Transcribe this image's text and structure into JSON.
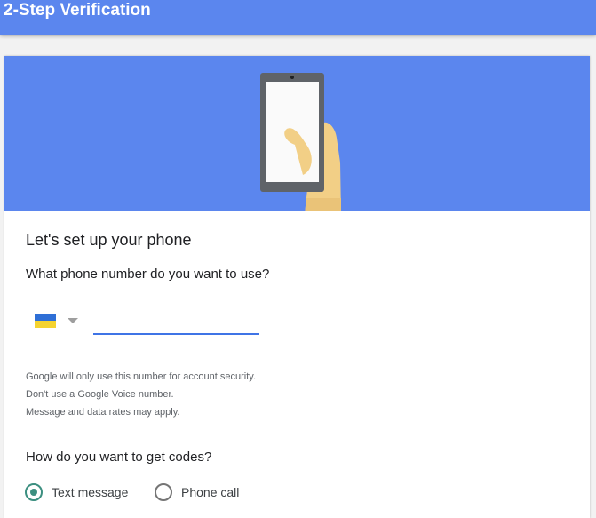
{
  "header": {
    "title": "2-Step Verification"
  },
  "hero": {
    "illustration": "hand-holding-phone",
    "background_color": "#5b86ee"
  },
  "setup": {
    "heading": "Let's set up your phone",
    "phone_question": "What phone number do you want to use?",
    "country": {
      "flag": "ukraine-flag-icon",
      "caret": "caret-down-icon"
    },
    "phone_input": {
      "value": "",
      "placeholder": ""
    },
    "notes": [
      "Google will only use this number for account security.",
      "Don't use a Google Voice number.",
      "Message and data rates may apply."
    ]
  },
  "codes": {
    "question": "How do you want to get codes?",
    "options": [
      {
        "label": "Text message",
        "selected": true
      },
      {
        "label": "Phone call",
        "selected": false
      }
    ]
  },
  "colors": {
    "accent": "#5b86ee",
    "input_underline": "#3f74e6",
    "radio_selected": "#3c8f80"
  }
}
